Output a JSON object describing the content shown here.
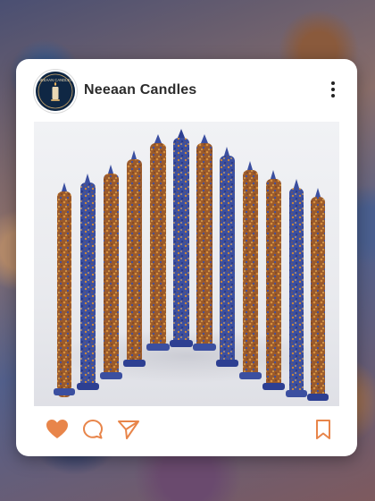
{
  "post": {
    "username": "Neeaan Candles",
    "avatar_text": "NEEAAN CANDLES",
    "avatar_icon": "candle-logo-icon",
    "menu_icon": "more-vertical-icon",
    "image_subject": "candles",
    "actions": {
      "like_icon": "heart-icon",
      "comment_icon": "comment-icon",
      "share_icon": "send-icon",
      "save_icon": "bookmark-icon",
      "accent_color": "#e8854a"
    }
  }
}
